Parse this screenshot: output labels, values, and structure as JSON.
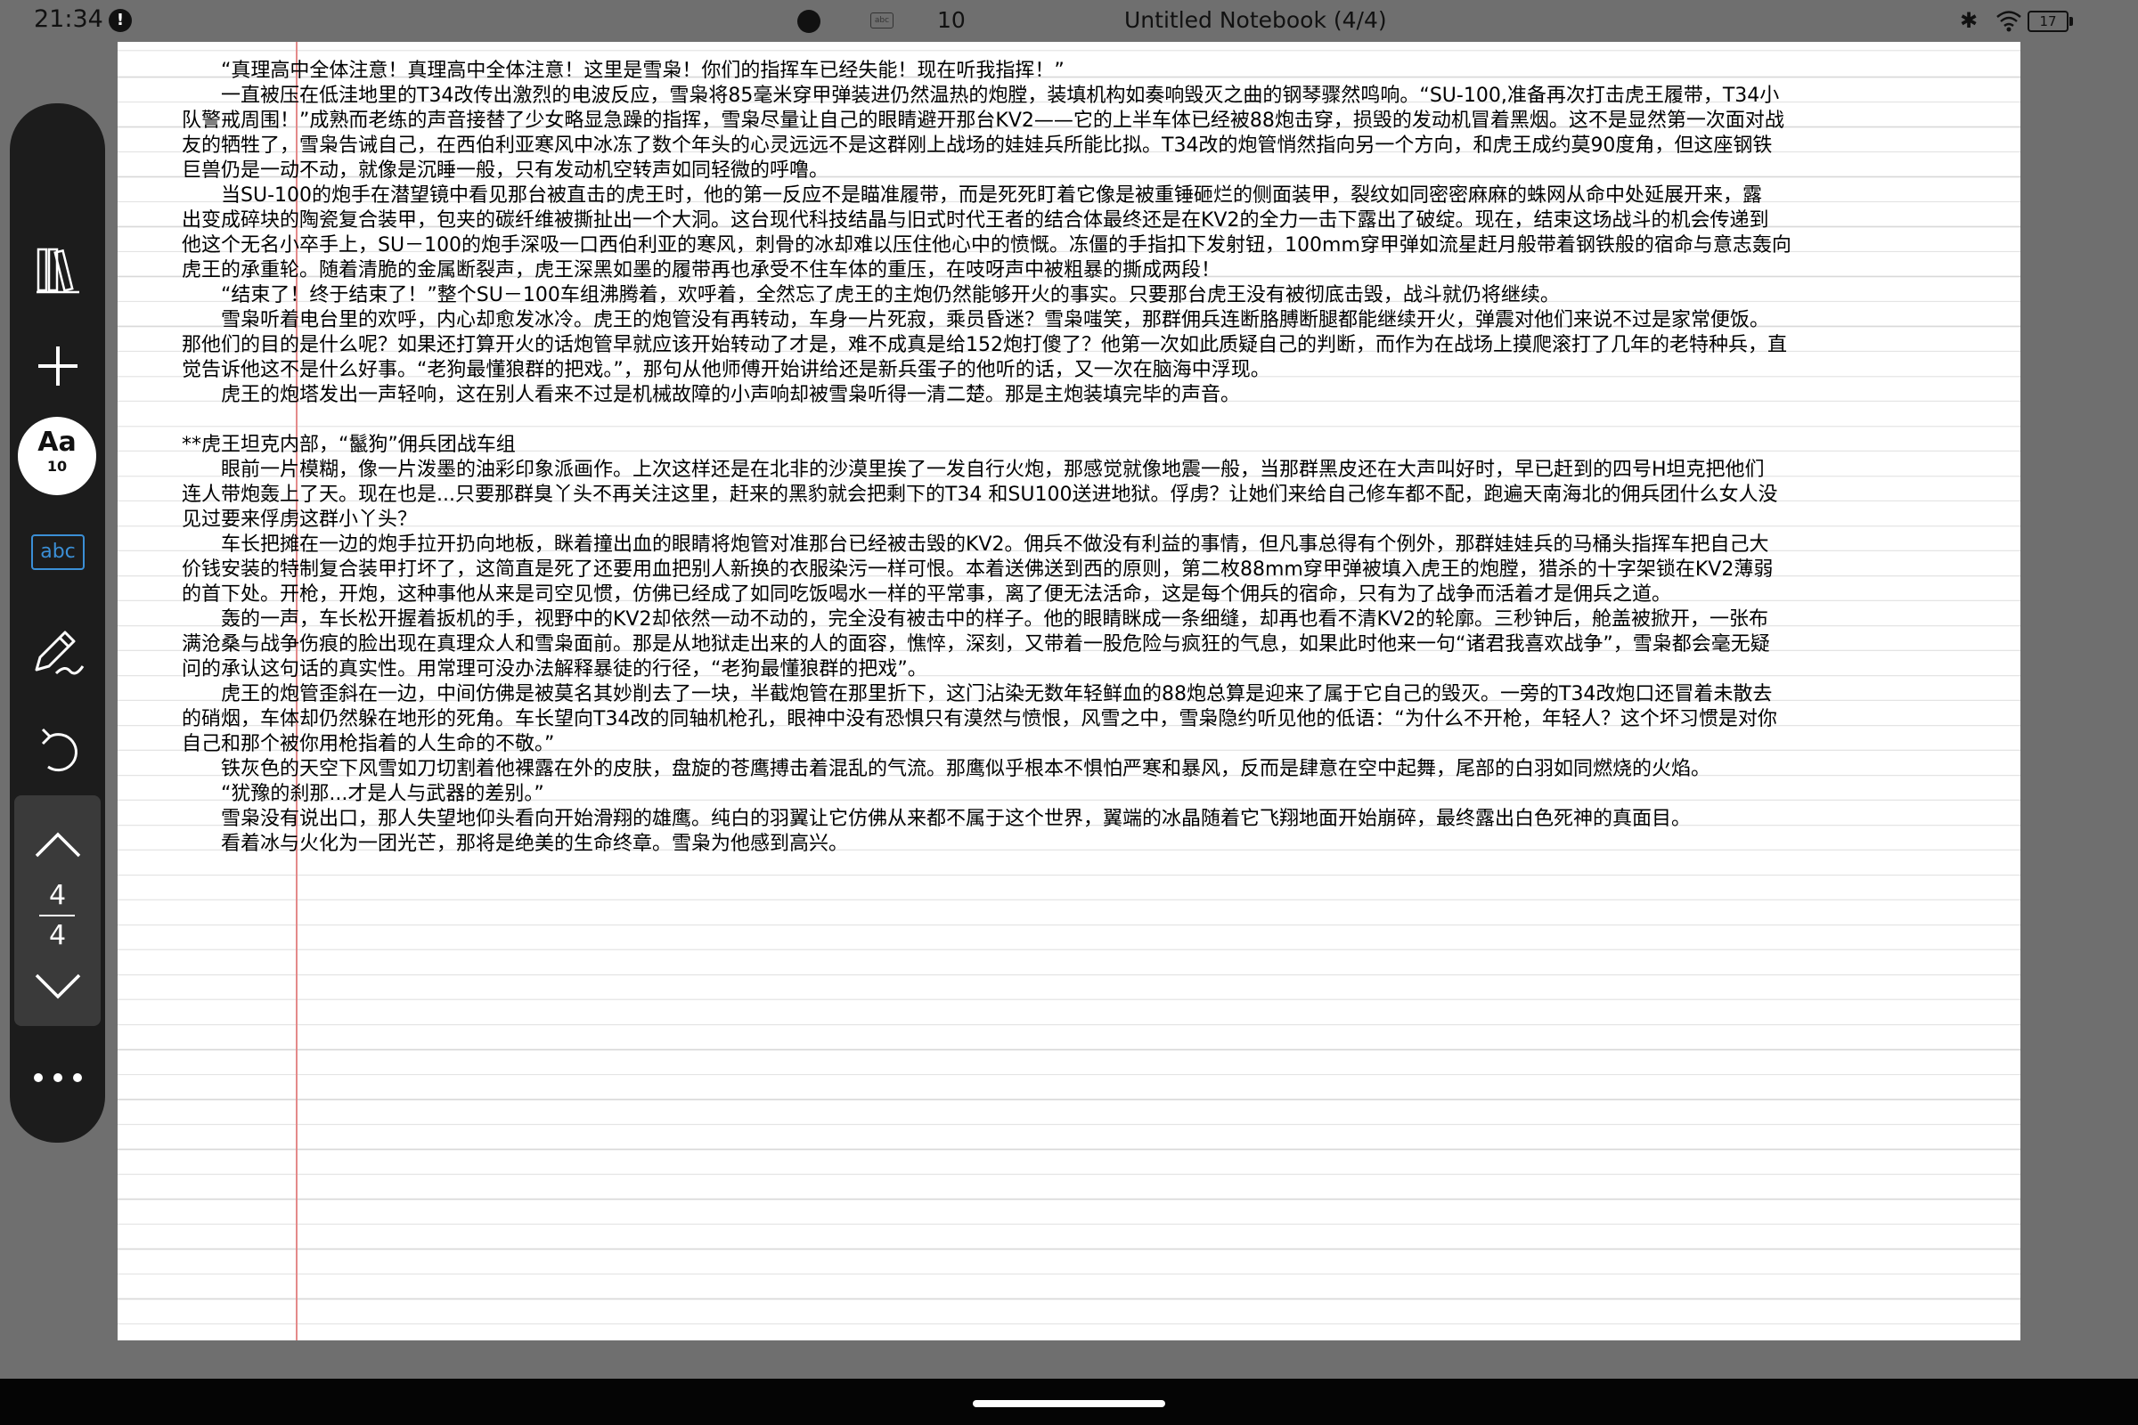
{
  "status": {
    "time": "21:34",
    "notification": "!",
    "abc": "abc",
    "count": "10",
    "title": "Untitled Notebook (4/4)",
    "bluetooth": "✱",
    "battery": "17"
  },
  "toolbar": {
    "font_label": "Aa",
    "font_size": "10",
    "abc_label": "abc",
    "page_current": "4",
    "page_total": "4"
  },
  "text": [
    "　　“真理高中全体注意！真理高中全体注意！这里是雪枭！你们的指挥车已经失能！现在听我指挥！”",
    "　　一直被压在低洼地里的T34改传出激烈的电波反应，雪枭将85毫米穿甲弹装进仍然温热的炮膛，装填机构如奏响毁灭之曲的钢琴骤然鸣响。“SU-100,准备再次打击虎王履带，T34小",
    "队警戒周围！”成熟而老练的声音接替了少女略显急躁的指挥，雪枭尽量让自己的眼睛避开那台KV2——它的上半车体已经被88炮击穿，损毁的发动机冒着黑烟。这不是显然第一次面对战",
    "友的牺牲了，雪枭告诫自己，在西伯利亚寒风中冰冻了数个年头的心灵远远不是这群刚上战场的娃娃兵所能比拟。T34改的炮管悄然指向另一个方向，和虎王成约莫90度角，但这座钢铁",
    "巨兽仍是一动不动，就像是沉睡一般，只有发动机空转声如同轻微的呼噜。",
    "　　当SU-100的炮手在潜望镜中看见那台被直击的虎王时，他的第一反应不是瞄准履带，而是死死盯着它像是被重锤砸烂的侧面装甲，裂纹如同密密麻麻的蛛网从命中处延展开来，露",
    "出变成碎块的陶瓷复合装甲，包夹的碳纤维被撕扯出一个大洞。这台现代科技结晶与旧式时代王者的结合体最终还是在KV2的全力一击下露出了破绽。现在，结束这场战斗的机会传递到",
    "他这个无名小卒手上，SU－100的炮手深吸一口西伯利亚的寒风，刺骨的冰却难以压住他心中的愤慨。冻僵的手指扣下发射钮，100mm穿甲弹如流星赶月般带着钢铁般的宿命与意志轰向",
    "虎王的承重轮。随着清脆的金属断裂声，虎王深黑如墨的履带再也承受不住车体的重压，在吱呀声中被粗暴的撕成两段！",
    "　　“结束了！终于结束了！”整个SU－100车组沸腾着，欢呼着，全然忘了虎王的主炮仍然能够开火的事实。只要那台虎王没有被彻底击毁，战斗就仍将继续。",
    "　　雪枭听着电台里的欢呼，内心却愈发冰冷。虎王的炮管没有再转动，车身一片死寂，乘员昏迷？雪枭嗤笑，那群佣兵连断胳膊断腿都能继续开火，弹震对他们来说不过是家常便饭。",
    "那他们的目的是什么呢？如果还打算开火的话炮管早就应该开始转动了才是，难不成真是给152炮打傻了？他第一次如此质疑自己的判断，而作为在战场上摸爬滚打了几年的老特种兵，直",
    "觉告诉他这不是什么好事。“老狗最懂狼群的把戏。”，那句从他师傅开始讲给还是新兵蛋子的他听的话，又一次在脑海中浮现。",
    "　　虎王的炮塔发出一声轻响，这在别人看来不过是机械故障的小声响却被雪枭听得一清二楚。那是主炮装填完毕的声音。",
    "",
    "**虎王坦克内部，“鬣狗”佣兵团战车组",
    "　　眼前一片模糊，像一片泼墨的油彩印象派画作。上次这样还是在北非的沙漠里挨了一发自行火炮，那感觉就像地震一般，当那群黑皮还在大声叫好时，早已赶到的四号H坦克把他们",
    "连人带炮轰上了天。现在也是...只要那群臭丫头不再关注这里，赶来的黑豹就会把剩下的T34 和SU100送进地狱。俘虏？让她们来给自己修车都不配，跑遍天南海北的佣兵团什么女人没",
    "见过要来俘虏这群小丫头？",
    "　　车长把摊在一边的炮手拉开扔向地板，眯着撞出血的眼睛将炮管对准那台已经被击毁的KV2。佣兵不做没有利益的事情，但凡事总得有个例外，那群娃娃兵的马桶头指挥车把自己大",
    "价钱安装的特制复合装甲打坏了，这简直是死了还要用血把别人新换的衣服染污一样可恨。本着送佛送到西的原则，第二枚88mm穿甲弹被填入虎王的炮膛，猎杀的十字架锁在KV2薄弱",
    "的首下处。开枪，开炮，这种事他从来是司空见惯，仿佛已经成了如同吃饭喝水一样的平常事，离了便无法活命，这是每个佣兵的宿命，只有为了战争而活着才是佣兵之道。",
    "　　轰的一声，车长松开握着扳机的手，视野中的KV2却依然一动不动的，完全没有被击中的样子。他的眼睛眯成一条细缝，却再也看不清KV2的轮廓。三秒钟后，舱盖被掀开，一张布",
    "满沧桑与战争伤痕的脸出现在真理众人和雪枭面前。那是从地狱走出来的人的面容，憔悴，深刻，又带着一股危险与疯狂的气息，如果此时他来一句“诸君我喜欢战争”，雪枭都会毫无疑",
    "问的承认这句话的真实性。用常理可没办法解释暴徒的行径，“老狗最懂狼群的把戏”。",
    "　　虎王的炮管歪斜在一边，中间仿佛是被莫名其妙削去了一块，半截炮管在那里折下，这门沾染无数年轻鲜血的88炮总算是迎来了属于它自己的毁灭。一旁的T34改炮口还冒着未散去",
    "的硝烟，车体却仍然躲在地形的死角。车长望向T34改的同轴机枪孔，眼神中没有恐惧只有漠然与愤恨，风雪之中，雪枭隐约听见他的低语：“为什么不开枪，年轻人？这个坏习惯是对你",
    "自己和那个被你用枪指着的人生命的不敬。”",
    "　　铁灰色的天空下风雪如刀切割着他裸露在外的皮肤，盘旋的苍鹰搏击着混乱的气流。那鹰似乎根本不惧怕严寒和暴风，反而是肆意在空中起舞，尾部的白羽如同燃烧的火焰。",
    "　　“犹豫的刹那...才是人与武器的差别。”",
    "　　雪枭没有说出口，那人失望地仰头看向开始滑翔的雄鹰。纯白的羽翼让它仿佛从来都不属于这个世界，翼端的冰晶随着它飞翔地面开始崩碎，最终露出白色死神的真面目。",
    "　　看着冰与火化为一团光芒，那将是绝美的生命终章。雪枭为他感到高兴。"
  ]
}
